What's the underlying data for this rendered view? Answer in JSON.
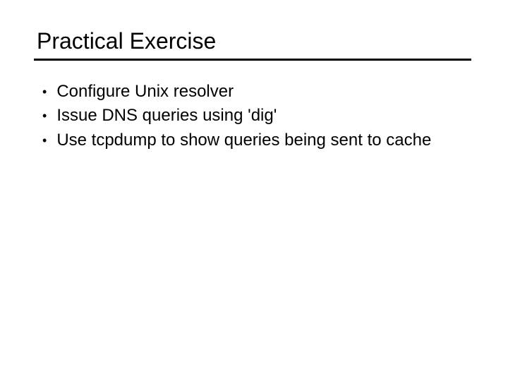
{
  "slide": {
    "title": "Practical Exercise",
    "bullets": [
      "Configure Unix resolver",
      "Issue DNS queries using 'dig'",
      "Use tcpdump to show queries being sent to cache"
    ]
  }
}
